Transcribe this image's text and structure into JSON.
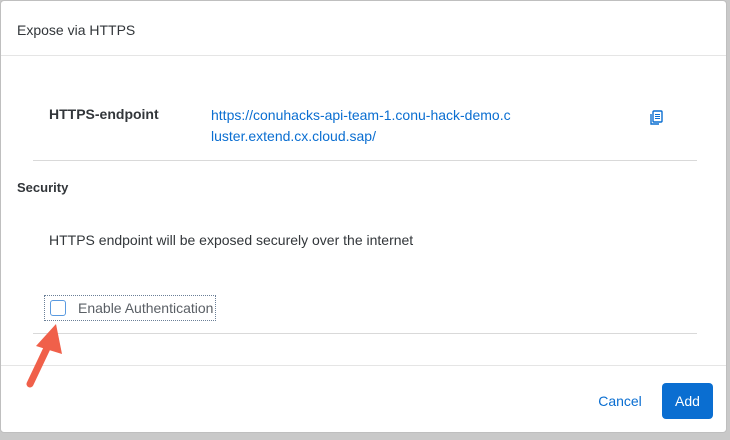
{
  "dialog": {
    "title": "Expose via HTTPS"
  },
  "endpoint": {
    "label": "HTTPS-endpoint",
    "url": "https://conuhacks-api-team-1.conu-hack-demo.cluster.extend.cx.cloud.sap/",
    "copy_icon": "copy-icon"
  },
  "security": {
    "label": "Security",
    "description": "HTTPS endpoint will be exposed securely over the internet",
    "auth_checkbox_label": "Enable Authentication",
    "auth_checked": false
  },
  "footer": {
    "cancel_label": "Cancel",
    "add_label": "Add"
  },
  "colors": {
    "accent": "#0a6ed1",
    "annotation_arrow": "#f0604a"
  }
}
